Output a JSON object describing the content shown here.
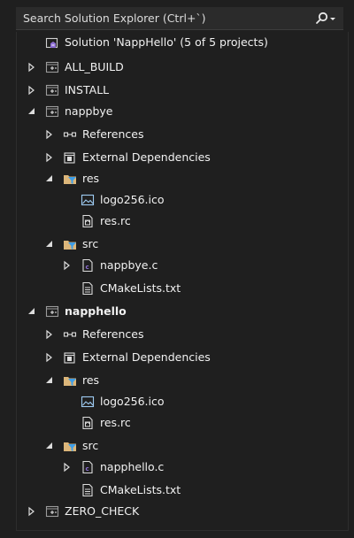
{
  "search": {
    "placeholder": "Search Solution Explorer (Ctrl+`)"
  },
  "tree": [
    {
      "label": "Solution 'NappHello' (5 of 5 projects)",
      "icon": "solution-icon",
      "expander": "none",
      "bold": false
    },
    {
      "label": "ALL_BUILD",
      "icon": "project-icon",
      "expander": "collapsed",
      "bold": false
    },
    {
      "label": "INSTALL",
      "icon": "project-icon",
      "expander": "collapsed",
      "bold": false
    },
    {
      "label": "nappbye",
      "icon": "project-icon",
      "expander": "expanded",
      "bold": false
    },
    {
      "label": "References",
      "icon": "references-icon",
      "expander": "collapsed",
      "bold": false
    },
    {
      "label": "External Dependencies",
      "icon": "external-dependencies-icon",
      "expander": "collapsed",
      "bold": false
    },
    {
      "label": "res",
      "icon": "filter-folder-icon",
      "expander": "expanded",
      "bold": false
    },
    {
      "label": "logo256.ico",
      "icon": "image-file-icon",
      "expander": "none",
      "bold": false
    },
    {
      "label": "res.rc",
      "icon": "resource-file-icon",
      "expander": "none",
      "bold": false
    },
    {
      "label": "src",
      "icon": "filter-folder-icon",
      "expander": "expanded",
      "bold": false
    },
    {
      "label": "nappbye.c",
      "icon": "c-file-icon",
      "expander": "collapsed",
      "bold": false
    },
    {
      "label": "CMakeLists.txt",
      "icon": "text-file-icon",
      "expander": "none",
      "bold": false
    },
    {
      "label": "napphello",
      "icon": "project-icon",
      "expander": "expanded",
      "bold": true
    },
    {
      "label": "References",
      "icon": "references-icon",
      "expander": "collapsed",
      "bold": false
    },
    {
      "label": "External Dependencies",
      "icon": "external-dependencies-icon",
      "expander": "collapsed",
      "bold": false
    },
    {
      "label": "res",
      "icon": "filter-folder-icon",
      "expander": "expanded",
      "bold": false
    },
    {
      "label": "logo256.ico",
      "icon": "image-file-icon",
      "expander": "none",
      "bold": false
    },
    {
      "label": "res.rc",
      "icon": "resource-file-icon",
      "expander": "none",
      "bold": false
    },
    {
      "label": "src",
      "icon": "filter-folder-icon",
      "expander": "expanded",
      "bold": false
    },
    {
      "label": "napphello.c",
      "icon": "c-file-icon",
      "expander": "collapsed",
      "bold": false
    },
    {
      "label": "CMakeLists.txt",
      "icon": "text-file-icon",
      "expander": "none",
      "bold": false
    },
    {
      "label": "ZERO_CHECK",
      "icon": "project-icon",
      "expander": "collapsed",
      "bold": false
    }
  ],
  "colors": {
    "background": "#1f1f1f",
    "text": "#f1f1f1",
    "folder": "#dcb67a",
    "filter_funnel": "#3e9ee8",
    "project_icon": "#9b9b9b",
    "solution_accent": "#8f6fd6"
  }
}
